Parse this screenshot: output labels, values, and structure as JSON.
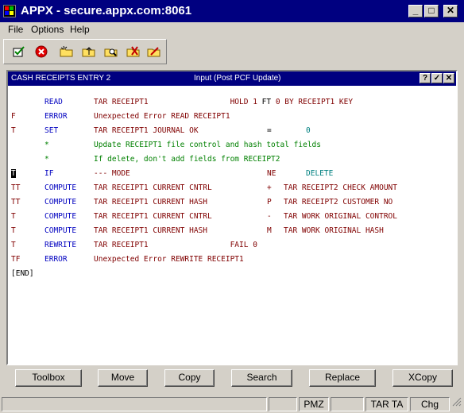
{
  "window": {
    "title": "APPX - secure.appx.com:8061"
  },
  "menu": {
    "file": "File",
    "options": "Options",
    "help": "Help"
  },
  "toolbar": {
    "tools": [
      "check-icon",
      "cancel-icon",
      "folder-new-icon",
      "folder-up-icon",
      "folder-search-icon",
      "folder-delete-icon"
    ]
  },
  "panel": {
    "title": "CASH RECEIPTS ENTRY 2",
    "mode": "Input  (Post PCF Update)",
    "help": "?"
  },
  "code": {
    "rows": [
      {
        "flag": "",
        "kw": "READ",
        "arg": "TAR RECEIPT1                  HOLD ",
        "op": "",
        "rest": ""
      },
      {
        "flag": "F",
        "kw": "ERROR",
        "arg": "Unexpected Error READ RECEIPT1",
        "op": "",
        "rest": ""
      },
      {
        "flag": "T",
        "kw": "SET",
        "arg": "TAR RECEIPT1 JOURNAL OK",
        "op": "=",
        "rest": "0"
      },
      {
        "flag": "",
        "kw": "*",
        "arg": "Update RECEIPT1 file control and hash total fields",
        "op": "",
        "rest": "",
        "comment": true
      },
      {
        "flag": "",
        "kw": "*",
        "arg": "If delete, don't add fields from RECEIPT2",
        "op": "",
        "rest": "",
        "comment": true
      },
      {
        "flag": "T",
        "kw": "IF",
        "arg": "--- MODE",
        "op": "NE",
        "rest": "DELETE"
      },
      {
        "flag": "TT",
        "kw": "COMPUTE",
        "arg": "TAR RECEIPT1 CURRENT CNTRL",
        "op": "+",
        "rest": "TAR RECEIPT2 CHECK AMOUNT"
      },
      {
        "flag": "TT",
        "kw": "COMPUTE",
        "arg": "TAR RECEIPT1 CURRENT HASH",
        "op": "P",
        "rest": "TAR RECEIPT2 CUSTOMER NO"
      },
      {
        "flag": "T",
        "kw": "COMPUTE",
        "arg": "TAR RECEIPT1 CURRENT CNTRL",
        "op": "-",
        "rest": "TAR WORK ORIGINAL CONTROL"
      },
      {
        "flag": "T",
        "kw": "COMPUTE",
        "arg": "TAR RECEIPT1 CURRENT HASH",
        "op": "M",
        "rest": "TAR WORK ORIGINAL HASH"
      },
      {
        "flag": "T",
        "kw": "REWRITE",
        "arg": "TAR RECEIPT1                  FAIL ",
        "op": "",
        "rest": ""
      },
      {
        "flag": "TF",
        "kw": "ERROR",
        "arg": "Unexpected Error REWRITE RECEIPT1",
        "op": "",
        "rest": ""
      }
    ],
    "read_suffix": {
      "num1": "1",
      "ft": " FT ",
      "num2": "0",
      "by": " BY RECEIPT1 KEY"
    },
    "rewrite_suffix": "0",
    "end": "[END]"
  },
  "buttons": {
    "toolbox": "Toolbox",
    "move": "Move",
    "copy": "Copy",
    "search": "Search",
    "replace": "Replace",
    "xcopy": "XCopy"
  },
  "status": {
    "pmz": "PMZ",
    "tar_ta": "TAR TA",
    "chg": "Chg"
  }
}
